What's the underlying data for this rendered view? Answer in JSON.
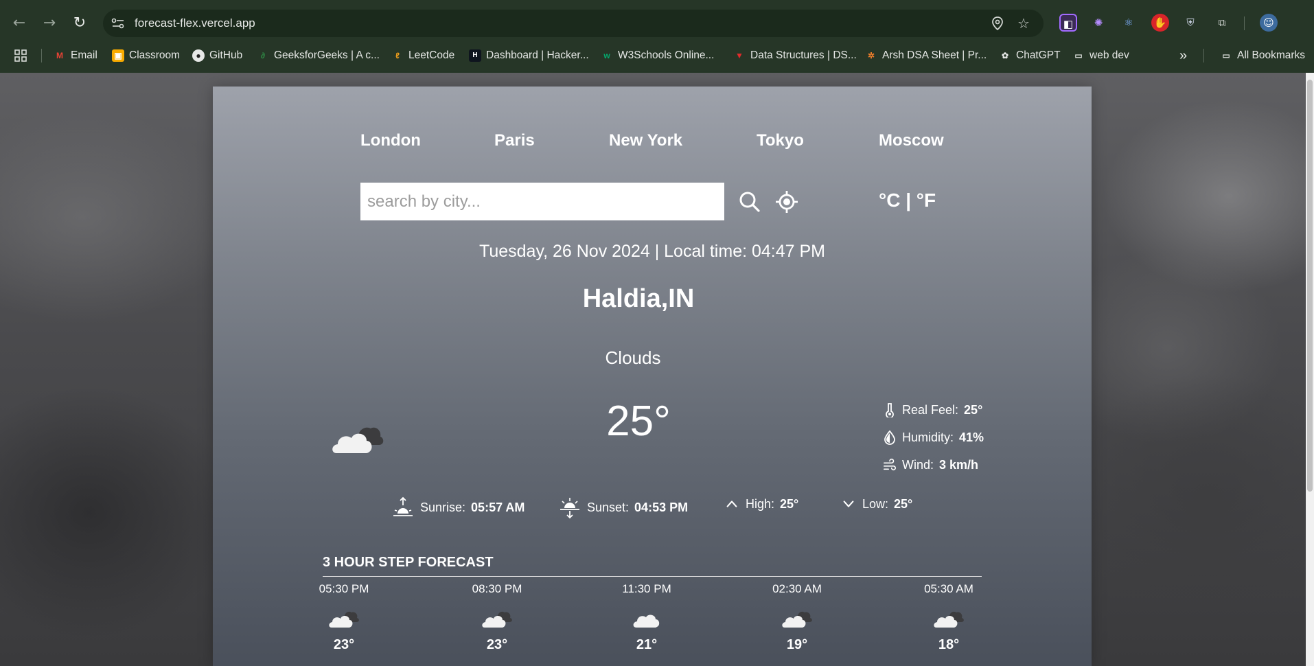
{
  "browser": {
    "url": "forecast-flex.vercel.app",
    "bookmarks": [
      {
        "label": "Email"
      },
      {
        "label": "Classroom"
      },
      {
        "label": "GitHub"
      },
      {
        "label": "GeeksforGeeks | A c..."
      },
      {
        "label": "LeetCode"
      },
      {
        "label": "Dashboard | Hacker..."
      },
      {
        "label": "W3Schools Online..."
      },
      {
        "label": "Data Structures | DS..."
      },
      {
        "label": "Arsh DSA Sheet | Pr..."
      },
      {
        "label": "ChatGPT"
      },
      {
        "label": "web dev"
      }
    ],
    "more_bookmarks": "»",
    "all_bookmarks": "All Bookmarks"
  },
  "app": {
    "cities": [
      "London",
      "Paris",
      "New York",
      "Tokyo",
      "Moscow"
    ],
    "search": {
      "placeholder": "search by city..."
    },
    "units": "°C | °F",
    "date_line": "Tuesday, 26 Nov 2024 | Local time: 04:47 PM",
    "location": "Haldia,IN",
    "condition": "Clouds",
    "temperature": "25°",
    "details": {
      "real_feel": {
        "label": "Real Feel:",
        "value": "25°"
      },
      "humidity": {
        "label": "Humidity:",
        "value": "41%"
      },
      "wind": {
        "label": "Wind:",
        "value": "3 km/h"
      }
    },
    "sun": {
      "sunrise": {
        "label": "Sunrise:",
        "value": "05:57 AM"
      },
      "sunset": {
        "label": "Sunset:",
        "value": "04:53 PM"
      },
      "high": {
        "label": "High:",
        "value": "25°"
      },
      "low": {
        "label": "Low:",
        "value": "25°"
      }
    },
    "forecast_title": "3 HOUR STEP FORECAST",
    "forecast": [
      {
        "time": "05:30 PM",
        "temp": "23°",
        "icon": "cloudy-icon"
      },
      {
        "time": "08:30 PM",
        "temp": "23°",
        "icon": "cloudy-icon"
      },
      {
        "time": "11:30 PM",
        "temp": "21°",
        "icon": "cloud-icon"
      },
      {
        "time": "02:30 AM",
        "temp": "19°",
        "icon": "cloudy-icon"
      },
      {
        "time": "05:30 AM",
        "temp": "18°",
        "icon": "cloudy-icon"
      }
    ]
  },
  "colors": {
    "chrome": "#263627",
    "panel_top": "#9ea2ab",
    "panel_bottom": "#4a505b",
    "text": "#ffffff"
  }
}
